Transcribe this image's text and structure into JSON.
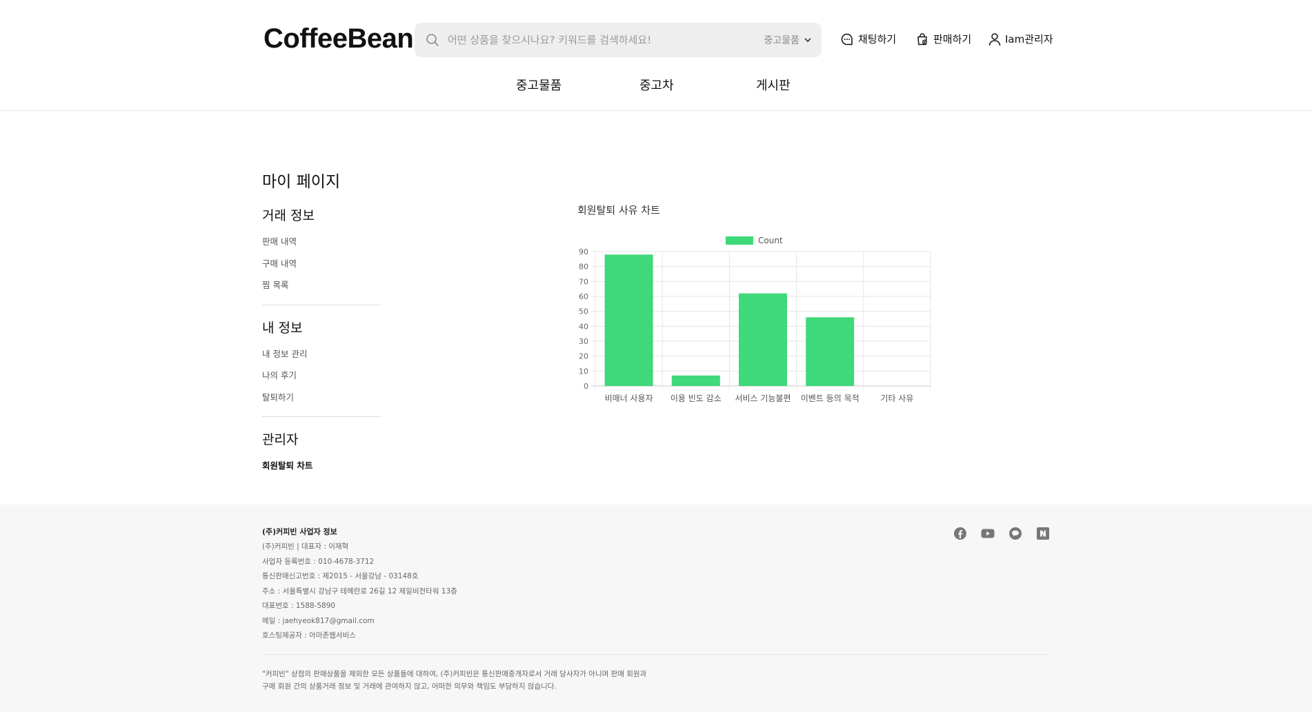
{
  "header": {
    "logo": "CoffeeBean",
    "search_placeholder": "어떤 상품을 찾으시나요? 키워드를 검색하세요!",
    "search_category": "중고물품",
    "chat_label": "채팅하기",
    "sell_label": "판매하기",
    "user_label": "Iam관리자"
  },
  "nav": {
    "items": [
      "중고물품",
      "중고차",
      "게시판"
    ]
  },
  "sidebar": {
    "title": "마이 페이지",
    "sections": [
      {
        "title": "거래 정보",
        "items": [
          "판매 내역",
          "구매 내역",
          "찜 목록"
        ]
      },
      {
        "title": "내 정보",
        "items": [
          "내 정보 관리",
          "나의 후기",
          "탈퇴하기"
        ]
      },
      {
        "title": "관리자",
        "items": [
          "회원탈퇴 차트"
        ]
      }
    ]
  },
  "main": {
    "chart_title": "회원탈퇴 사유 차트"
  },
  "chart_data": {
    "type": "bar",
    "categories": [
      "비매너 사용자",
      "이용 빈도 감소",
      "서비스 기능불편",
      "이벤트 등의 목적",
      "기타 사유"
    ],
    "series": [
      {
        "name": "Count",
        "values": [
          88,
          7,
          62,
          46,
          0
        ]
      }
    ],
    "ylim": [
      0,
      90
    ],
    "yticks": [
      0,
      10,
      20,
      30,
      40,
      50,
      60,
      70,
      80,
      90
    ],
    "legend": "top",
    "grid": true,
    "color": "#3fd87a"
  },
  "footer": {
    "title": "(주)커피빈 사업자 정보",
    "lines": [
      "(주)커피빈 | 대표자 : 이재혁",
      "사업자 등록번호 : 010-4678-3712",
      "통신판매신고번호 : 제2015 - 서울강남 - 03148호",
      "주소 : 서울특별시 강남구 테헤란로 26길 12 제일비전타워 13층",
      "대표번호 : 1588-5890",
      "메일 : jaehyeok817@gmail.com",
      "호스팅제공자 : 아마존웹서비스"
    ],
    "disclaimer": [
      "\"커피빈\" 상점의 판매상품을 제외한 모든 상품들에 대하여, (주)커피빈은 통신판매중개자로서 거래 당사자가 아니며 판매 회원과",
      "구매 회원 간의 상품거래 정보 및 거래에 관여하지 않고, 어떠한 의무와 책임도 부담하지 않습니다."
    ],
    "social_icons": [
      "facebook-icon",
      "youtube-icon",
      "kakao-icon",
      "naver-icon"
    ]
  }
}
